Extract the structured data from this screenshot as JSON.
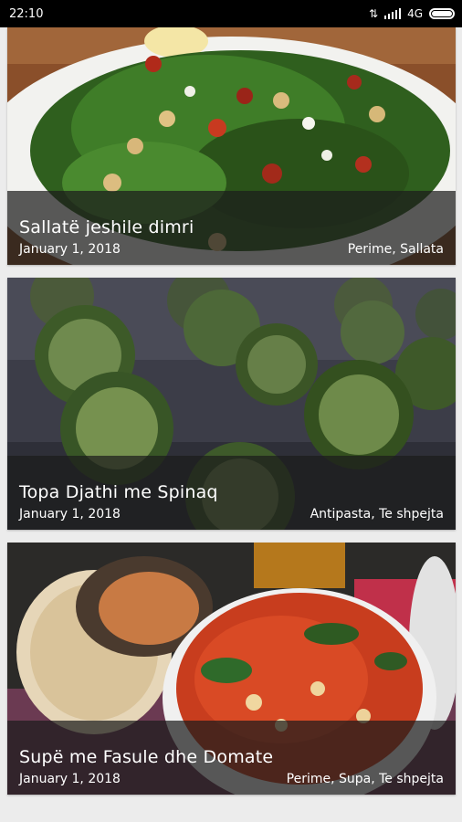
{
  "status_bar": {
    "time": "22:10",
    "network": "4G"
  },
  "recipes": [
    {
      "title": "Sallatë jeshile dimri",
      "date": "January 1, 2018",
      "categories": "Perime, Sallata"
    },
    {
      "title": "Topa Djathi me Spinaq",
      "date": "January 1, 2018",
      "categories": "Antipasta, Te shpejta"
    },
    {
      "title": "Supë me Fasule dhe Domate",
      "date": "January 1, 2018",
      "categories": "Perime, Supa, Te shpejta"
    }
  ],
  "colors": {
    "overlay": "#1c1c1c",
    "background": "#ececec"
  }
}
